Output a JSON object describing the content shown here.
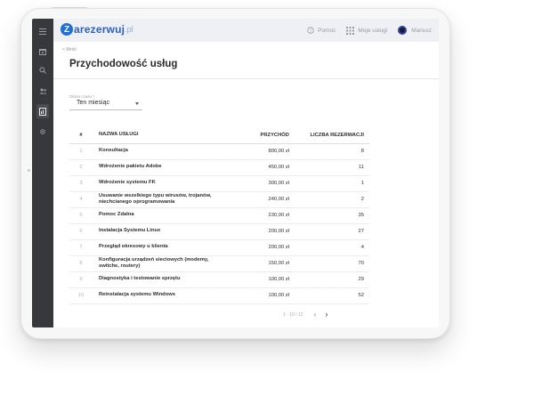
{
  "app": {
    "logo_letter": "Z",
    "logo_text": "arezerwuj",
    "logo_tld": ".pl"
  },
  "topbar": {
    "help_label": "Pomoc",
    "services_label": "Moje usługi",
    "user_name": "Mariusz"
  },
  "header": {
    "back_label": "< Wróć",
    "title": "Przychodowość usług"
  },
  "filter": {
    "label": "Okres czasu *",
    "value": "Ten miesiąc"
  },
  "table": {
    "columns": [
      "#",
      "NAZWA USŁUGI",
      "PRZYCHÓD",
      "LICZBA REZERWACJI"
    ],
    "rows": [
      {
        "n": "1",
        "name": "Konsultacja",
        "revenue": "800,00 zł",
        "count": "8"
      },
      {
        "n": "2",
        "name": "Wdrożenie pakietu Adobe",
        "revenue": "450,00 zł",
        "count": "11"
      },
      {
        "n": "3",
        "name": "Wdrożenie systemu FK",
        "revenue": "300,00 zł",
        "count": "1"
      },
      {
        "n": "4",
        "name": "Usuwanie wszelkiego typu wirusów, trojanów, niechcianego oprogramowania",
        "revenue": "240,00 zł",
        "count": "2"
      },
      {
        "n": "5",
        "name": "Pomoc Zdalna",
        "revenue": "230,00 zł",
        "count": "35"
      },
      {
        "n": "6",
        "name": "Instalacja Systemu Linux",
        "revenue": "200,00 zł",
        "count": "27"
      },
      {
        "n": "7",
        "name": "Przegląd okresowy u klienta",
        "revenue": "200,00 zł",
        "count": "4"
      },
      {
        "n": "8",
        "name": "Konfiguracja urządzeń sieciowych (modemy, switche, routery)",
        "revenue": "150,00 zł",
        "count": "70"
      },
      {
        "n": "9",
        "name": "Diagnostyka i testowanie sprzętu",
        "revenue": "100,00 zł",
        "count": "29"
      },
      {
        "n": "10",
        "name": "Reinstalacja systemu Windows",
        "revenue": "100,00 zł",
        "count": "52"
      }
    ]
  },
  "pagination": {
    "range": "1 - 10 / 12",
    "prev": "‹",
    "next": "›"
  },
  "sidebar": {
    "icons": [
      "menu-icon",
      "calendar-icon",
      "search-icon",
      "users-icon",
      "reports-icon",
      "settings-icon"
    ],
    "active": "reports-icon"
  },
  "colors": {
    "sidebar_bg": "#37383b",
    "topbar_bg": "#eef0f4",
    "brand_blue": "#1f6fd6"
  }
}
